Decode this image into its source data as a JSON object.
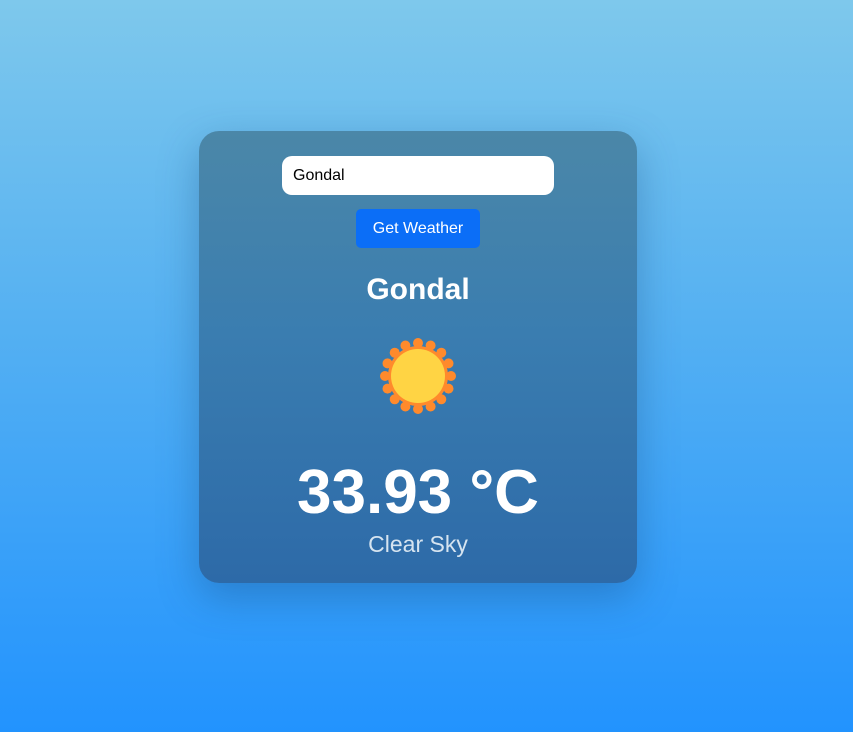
{
  "search": {
    "value": "Gondal"
  },
  "button": {
    "label": "Get Weather"
  },
  "weather": {
    "city": "Gondal",
    "icon": "sun-icon",
    "temperature": "33.93 °C",
    "description": "Clear Sky"
  },
  "colors": {
    "button": "#0b6ef7",
    "sun_core": "#ffd444",
    "sun_rays": "#ff8a2c"
  }
}
